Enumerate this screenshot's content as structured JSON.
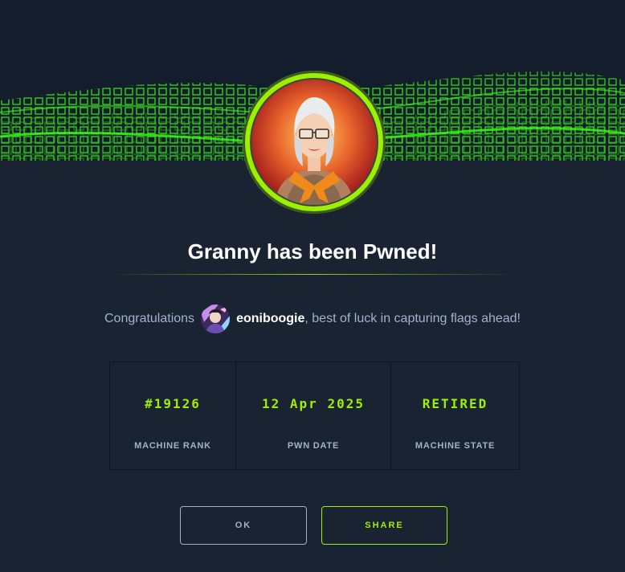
{
  "banner": {
    "title": "Granny has been Pwned!"
  },
  "congrats": {
    "prefix": "Congratulations",
    "username": "eoniboogie",
    "suffix": ", best of luck in capturing flags ahead!"
  },
  "stats": [
    {
      "value": "#19126",
      "label": "MACHINE RANK"
    },
    {
      "value": "12 Apr 2025",
      "label": "PWN DATE"
    },
    {
      "value": "RETIRED",
      "label": "MACHINE STATE"
    }
  ],
  "buttons": {
    "ok_label": "OK",
    "share_label": "SHARE"
  },
  "colors": {
    "accent": "#9fef00",
    "background": "#1a2332",
    "muted_text": "#a4b1cd"
  },
  "icons": {
    "machine_avatar": "granny-machine-avatar",
    "user_avatar": "user-avatar"
  }
}
